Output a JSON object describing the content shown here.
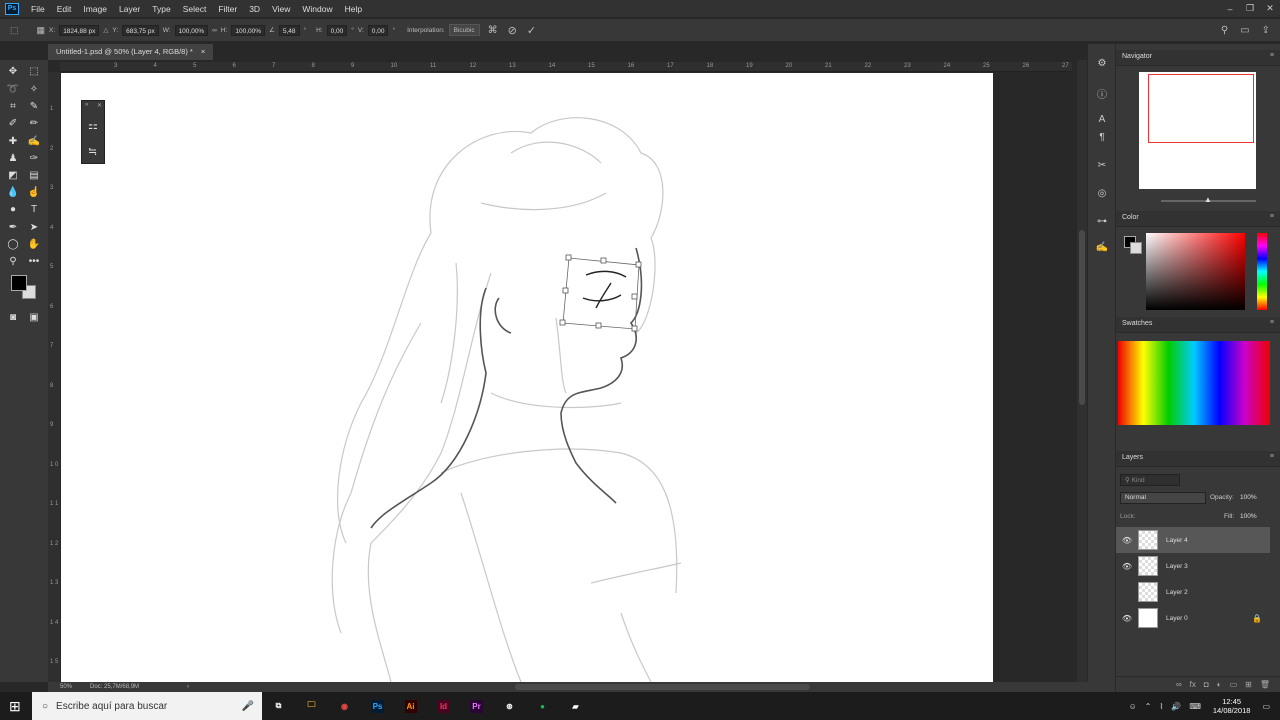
{
  "app": {
    "logo": "Ps"
  },
  "menu": [
    "File",
    "Edit",
    "Image",
    "Layer",
    "Type",
    "Select",
    "Filter",
    "3D",
    "View",
    "Window",
    "Help"
  ],
  "options": {
    "x_label": "X:",
    "x": "1824,88 px",
    "y_label": "Y:",
    "y": "683,75 px",
    "w_label": "W:",
    "w": "100,00%",
    "h_label": "H:",
    "h": "100,00%",
    "angle": "5,48",
    "hskew_label": "H:",
    "hskew": "0,00",
    "vskew_label": "V:",
    "vskew": "0,00",
    "deg": "°",
    "interp_label": "Interpolation:",
    "interp": "Bicubic"
  },
  "document_tab": {
    "title": "Untitled-1.psd @ 50% (Layer 4, RGB/8) *",
    "close": "×"
  },
  "ruler": {
    "top": [
      "3",
      "4",
      "5",
      "6",
      "7",
      "8",
      "9",
      "10",
      "11",
      "12",
      "13",
      "14",
      "15",
      "16",
      "17",
      "18",
      "19",
      "20",
      "21",
      "22",
      "23",
      "24",
      "25",
      "26",
      "27"
    ],
    "left": [
      "1",
      "2",
      "3",
      "4",
      "5",
      "6",
      "7",
      "8",
      "9",
      "1 0",
      "1 1",
      "1 2",
      "1 3",
      "1 4",
      "1 5"
    ]
  },
  "status": {
    "zoom": "50%",
    "doc": "Doc: 25,7M/68,9M",
    "arrow": "›"
  },
  "panels": {
    "navigator": "Navigator",
    "color": "Color",
    "swatches": "Swatches",
    "layers": "Layers",
    "kind_placeholder": "Kind",
    "blend": "Normal",
    "opacity_label": "Opacity:",
    "opacity": "100%",
    "lock_label": "Lock:",
    "fill_label": "Fill:",
    "fill": "100%"
  },
  "layers": [
    {
      "name": "Layer 4",
      "visible": true,
      "selected": true,
      "locked": false
    },
    {
      "name": "Layer 3",
      "visible": true,
      "selected": false,
      "locked": false
    },
    {
      "name": "Layer 2",
      "visible": false,
      "selected": false,
      "locked": false
    },
    {
      "name": "Layer 0",
      "visible": true,
      "selected": false,
      "locked": true
    }
  ],
  "taskbar": {
    "search_placeholder": "Escribe aquí para buscar",
    "apps": [
      {
        "label": "Ps",
        "color": "#31a8ff",
        "bg": "#001d34"
      },
      {
        "label": "Ai",
        "color": "#ff9a00",
        "bg": "#330000"
      },
      {
        "label": "Id",
        "color": "#ff3366",
        "bg": "#49021f"
      },
      {
        "label": "Pr",
        "color": "#ea77ff",
        "bg": "#2a0634"
      }
    ],
    "time": "12:45",
    "date": "14/08/2018"
  },
  "swatch_colors": [
    "#ff0000",
    "#ffff00",
    "#00ff00",
    "#00ffff",
    "#0000ff",
    "#ff00ff",
    "#ffffff",
    "#e6e6e6",
    "#cccccc",
    "#b3b3b3",
    "#999999",
    "#808080",
    "#666666",
    "#4d4d4d",
    "#333333",
    "#1a1a1a",
    "#000000",
    "#ff7f00",
    "#00a651",
    "#2e3192",
    "#92278f",
    "#ed1c24",
    "#f7941d",
    "#fff200",
    "#8dc63f",
    "#00aeef",
    "#ec008c",
    "#662d91",
    "#c69c6d",
    "#754c24",
    "#ffffff",
    "#8c6239"
  ]
}
